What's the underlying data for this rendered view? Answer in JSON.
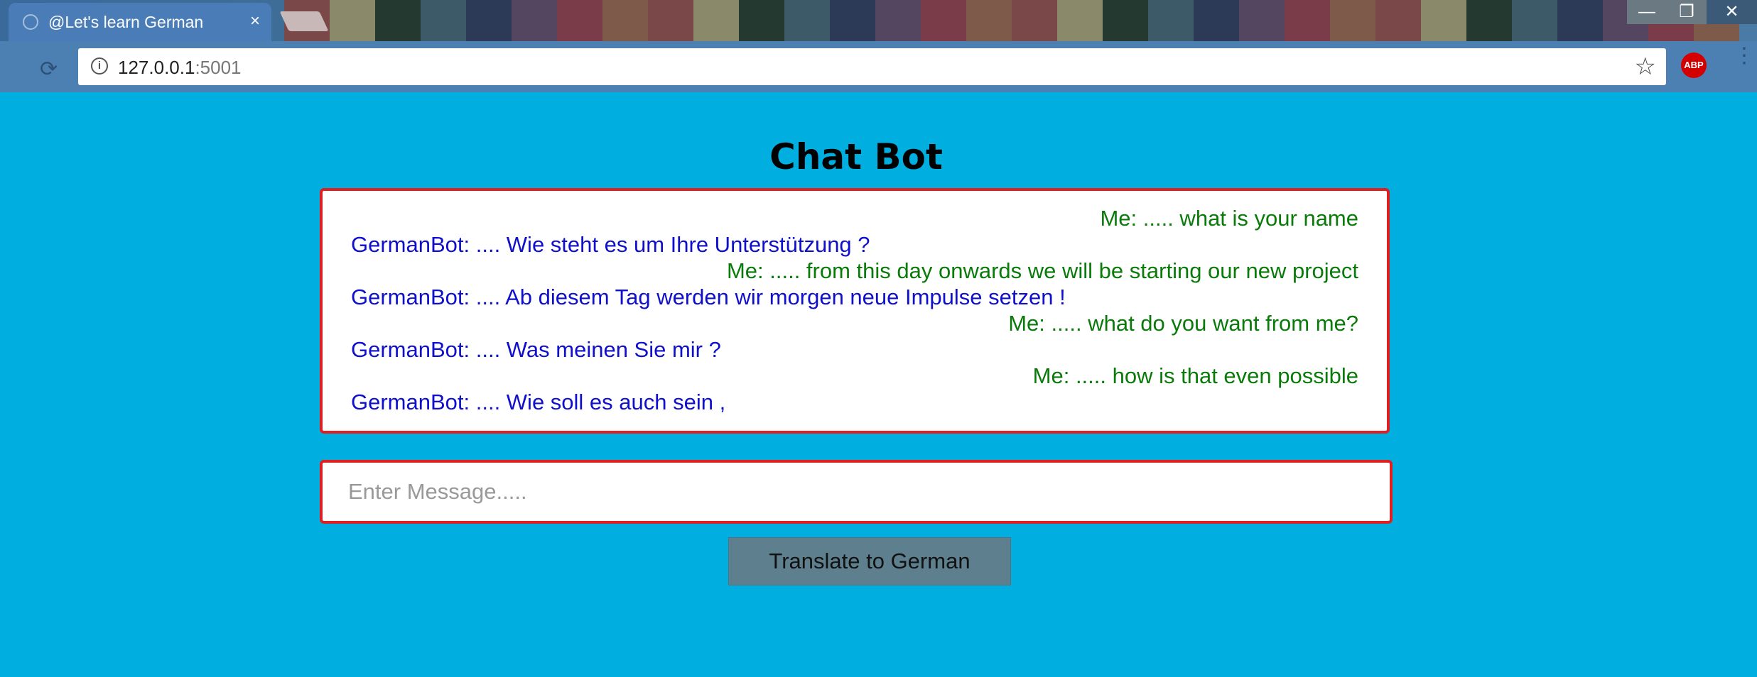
{
  "browser": {
    "tab_title": "@Let's learn German",
    "tab_close": "×",
    "url_host": "127.0.0.1",
    "url_port": ":5001",
    "info_icon": "info-icon",
    "bookmark_icon": "star-icon",
    "extension_label": "ABP",
    "window_controls": {
      "minimize": "—",
      "maximize": "❐",
      "close": "✕"
    },
    "stripe_colors": [
      "#7a4848",
      "#8a8a6a",
      "#243a30",
      "#3c5a68",
      "#2c3a58",
      "#544660",
      "#7a3c48",
      "#7e5a4a"
    ]
  },
  "page": {
    "title": "Chat Bot",
    "messages": [
      {
        "sender": "me",
        "text": "Me: ..... what is your name"
      },
      {
        "sender": "bot",
        "text": "GermanBot: .... Wie steht es um Ihre Unterstützung ?"
      },
      {
        "sender": "me",
        "text": "Me: ..... from this day onwards we will be starting our new project"
      },
      {
        "sender": "bot",
        "text": "GermanBot: .... Ab diesem Tag werden wir morgen neue Impulse setzen !"
      },
      {
        "sender": "me",
        "text": "Me: ..... what do you want from me?"
      },
      {
        "sender": "bot",
        "text": "GermanBot: .... Was meinen Sie mir ?"
      },
      {
        "sender": "me",
        "text": "Me: ..... how is that even possible"
      },
      {
        "sender": "bot",
        "text": "GermanBot: .... Wie soll es auch sein ,"
      }
    ],
    "input": {
      "placeholder": "Enter Message.....",
      "value": ""
    },
    "translate_button": "Translate to German"
  },
  "colors": {
    "page_background": "#00aee0",
    "me_text": "#0a7a0a",
    "bot_text": "#1010cc",
    "box_border": "#e02020",
    "button_background": "#5e7f8e"
  }
}
